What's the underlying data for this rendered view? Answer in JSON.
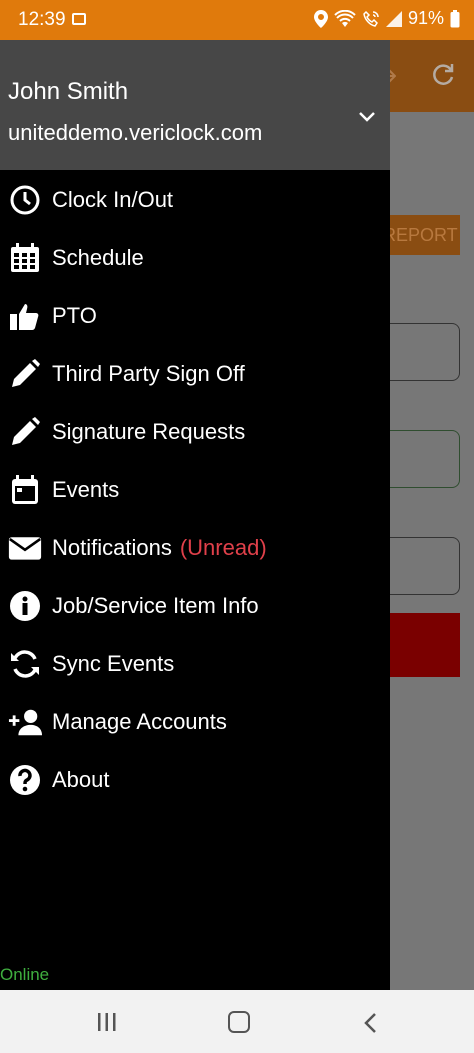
{
  "status_bar": {
    "time": "12:39",
    "battery": "91%"
  },
  "background": {
    "report_label": "REPORT"
  },
  "drawer": {
    "user_name": "John Smith",
    "domain": "uniteddemo.vericlock.com",
    "items": [
      {
        "label": "Clock In/Out",
        "icon": "clock-icon"
      },
      {
        "label": "Schedule",
        "icon": "calendar-icon"
      },
      {
        "label": "PTO",
        "icon": "thumbs-up-icon"
      },
      {
        "label": "Third Party Sign Off",
        "icon": "pencil-icon"
      },
      {
        "label": "Signature Requests",
        "icon": "pencil-icon"
      },
      {
        "label": "Events",
        "icon": "calendar-event-icon"
      },
      {
        "label": "Notifications",
        "icon": "envelope-icon",
        "badge": "(Unread)"
      },
      {
        "label": "Job/Service Item Info",
        "icon": "info-icon"
      },
      {
        "label": "Sync Events",
        "icon": "sync-icon"
      },
      {
        "label": "Manage Accounts",
        "icon": "add-person-icon"
      },
      {
        "label": "About",
        "icon": "question-icon"
      }
    ],
    "connection_status": "Online"
  },
  "colors": {
    "status_bar": "#e07a0c",
    "drawer_bg": "#000000",
    "drawer_header": "#474747",
    "unread": "#e0404a",
    "online": "#3fae3f"
  }
}
